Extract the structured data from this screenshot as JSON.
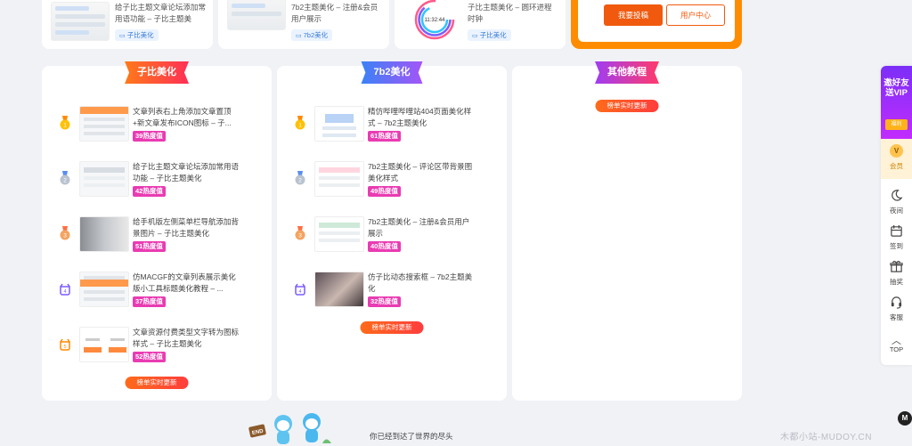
{
  "top_cards": [
    {
      "title": "给子比主题文章论坛添加常用语功能 – 子比主题美",
      "tag": "子比美化"
    },
    {
      "title": "7b2主题美化 – 注册&会员用户展示",
      "tag": "7b2美化"
    },
    {
      "title": "子比主题美化 – 圆环进程时钟",
      "tag": "子比美化",
      "clock_time": "11:32:44"
    }
  ],
  "top_actions": {
    "submit": "我要投稿",
    "user_center": "用户中心"
  },
  "panels": [
    {
      "title": "子比美化",
      "items": [
        {
          "rank": "1",
          "title": "文章列表右上角添加文章置顶+新文章发布ICON图标 – 子...",
          "hot": "39热度值"
        },
        {
          "rank": "2",
          "title": "给子比主题文章论坛添加常用语功能 – 子比主题美化",
          "hot": "42热度值"
        },
        {
          "rank": "3",
          "title": "给手机版左侧菜单栏导航添加背景图片 – 子比主题美化",
          "hot": "51热度值"
        },
        {
          "rank": "4",
          "title": "仿MACGF的文章列表展示美化版小工具标题美化教程 – ...",
          "hot": "37热度值"
        },
        {
          "rank": "5",
          "title": "文章资源付费类型文字转为图标样式 – 子比主题美化",
          "hot": "52热度值"
        }
      ],
      "update_label": "榜单实时更新"
    },
    {
      "title": "7b2美化",
      "items": [
        {
          "rank": "1",
          "title": "精仿哔哩哔哩站404页面美化样式 – 7b2主题美化",
          "hot": "61热度值"
        },
        {
          "rank": "2",
          "title": "7b2主题美化 – 评论区带背景图美化样式",
          "hot": "49热度值"
        },
        {
          "rank": "3",
          "title": "7b2主题美化 – 注册&会员用户展示",
          "hot": "40热度值"
        },
        {
          "rank": "4",
          "title": "仿子比动态搜索框 – 7b2主题美化",
          "hot": "32热度值"
        }
      ],
      "update_label": "榜单实时更新"
    },
    {
      "title": "其他教程",
      "items": [],
      "update_label": "榜单实时更新"
    }
  ],
  "sidebar": {
    "vip_promo": "邀好友送VIP",
    "vip_badge": "福利",
    "member_coin": "V",
    "member": "会员",
    "night": "夜间",
    "checkin": "签到",
    "lottery": "抽奖",
    "service": "客服",
    "top": "TOP"
  },
  "footer": {
    "end_text": "你已经到达了世界的尽头",
    "mascot_sign": "END",
    "watermark": "木都小站-MUDOY.CN",
    "watermark_icon": "M"
  },
  "colors": {
    "accent_orange": "#ff8c00",
    "submit_red": "#f15a0e",
    "hot_pink": "#e93bb2",
    "vip_purple": "#7b2ff7"
  }
}
